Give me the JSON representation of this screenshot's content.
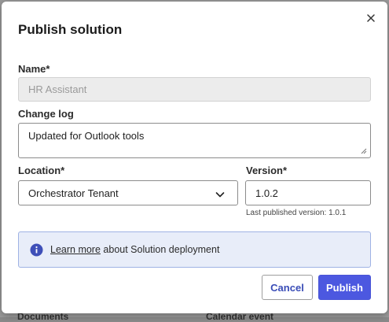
{
  "background": {
    "left_text": "Documents",
    "right_text": "Calendar event"
  },
  "dialog": {
    "title": "Publish solution",
    "close_icon": "close-icon"
  },
  "form": {
    "name": {
      "label": "Name*",
      "value": "HR Assistant"
    },
    "change_log": {
      "label": "Change log",
      "value": "Updated for Outlook tools"
    },
    "location": {
      "label": "Location*",
      "selected": "Orchestrator Tenant"
    },
    "version": {
      "label": "Version*",
      "value": "1.0.2",
      "hint": "Last published version: 1.0.1"
    }
  },
  "info": {
    "icon": "info-icon",
    "link_text": "Learn more",
    "text": " about Solution deployment"
  },
  "actions": {
    "cancel_label": "Cancel",
    "publish_label": "Publish"
  },
  "colors": {
    "primary": "#4c58e0",
    "info_bg": "#e8edf9",
    "info_border": "#9fb2e4",
    "info_icon": "#3e4fb8"
  }
}
